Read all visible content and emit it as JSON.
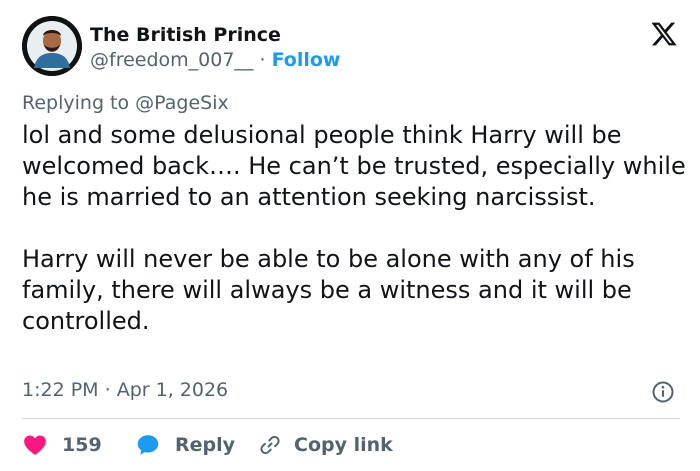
{
  "author": {
    "display_name": "The British Prince",
    "handle": "@freedom_007__",
    "separator": "·",
    "follow_label": "Follow"
  },
  "reply_context": {
    "prefix": "Replying to",
    "mention": "@PageSix"
  },
  "tweet": {
    "text": "lol and some delusional people think Harry will be welcomed back…. He can’t be trusted, especially while he is married to an attention seeking narcissist.\n\nHarry will never be able to be alone with any of his family, there will always be a witness and it will be controlled.",
    "time": "1:22 PM",
    "separator": "·",
    "date": "Apr 1, 2026"
  },
  "actions": {
    "like_count": "159",
    "reply_label": "Reply",
    "copy_link_label": "Copy link"
  },
  "icons": {
    "logo": "x-logo-icon",
    "info": "info-icon",
    "like": "heart-icon",
    "reply": "speech-bubble-icon",
    "copy": "link-icon"
  },
  "colors": {
    "accent": "#1d9bf0",
    "like": "#f91880",
    "muted": "#536471",
    "text": "#0f1419"
  }
}
